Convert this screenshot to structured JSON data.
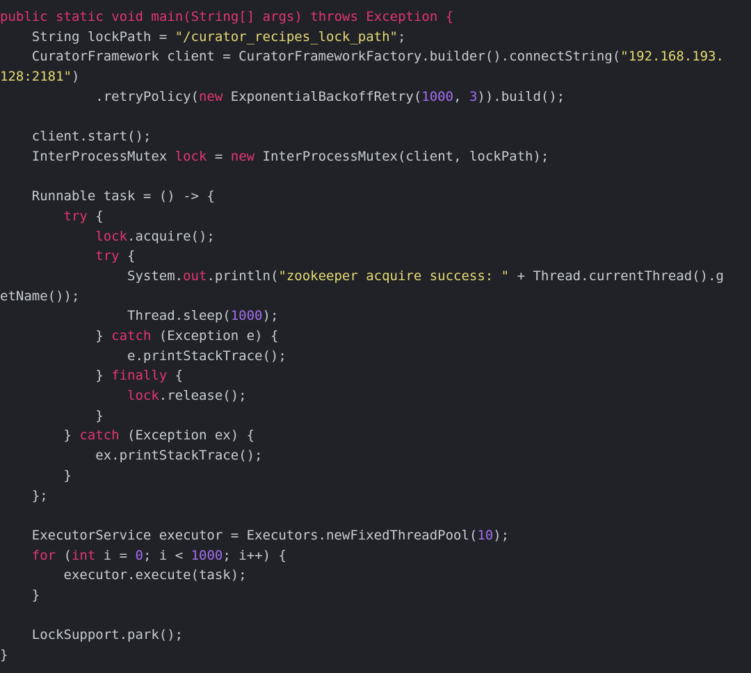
{
  "editor": {
    "language": "java",
    "background_color": "#212227",
    "default_text_color": "#c8cdd4",
    "keyword_color": "#e3366f",
    "string_color": "#e6db74",
    "number_color": "#a06ef0",
    "font_size_px": 19,
    "line_height_px": 28.7,
    "word_wrap": true,
    "total_visual_lines": 33
  },
  "code": {
    "lines": [
      {
        "index": 0,
        "text": "public static void main(String[] args) throws Exception {",
        "tokens": [
          {
            "t": "public",
            "c": "kw"
          },
          {
            "t": " ",
            "c": "pln"
          },
          {
            "t": "static",
            "c": "kw"
          },
          {
            "t": " ",
            "c": "pln"
          },
          {
            "t": "void",
            "c": "kw"
          },
          {
            "t": " ",
            "c": "pln"
          },
          {
            "t": "main",
            "c": "ent"
          },
          {
            "t": "(",
            "c": "ent"
          },
          {
            "t": "String[]",
            "c": "ent"
          },
          {
            "t": " ",
            "c": "pln"
          },
          {
            "t": "args",
            "c": "ent"
          },
          {
            "t": ")",
            "c": "ent"
          },
          {
            "t": " ",
            "c": "pln"
          },
          {
            "t": "throws",
            "c": "kw"
          },
          {
            "t": " ",
            "c": "pln"
          },
          {
            "t": "Exception",
            "c": "ent"
          },
          {
            "t": " {",
            "c": "ent"
          }
        ]
      },
      {
        "index": 1,
        "text": "    String lockPath = \"/curator_recipes_lock_path\";",
        "tokens": [
          {
            "t": "    String lockPath = ",
            "c": "pln"
          },
          {
            "t": "\"/curator_recipes_lock_path\"",
            "c": "str"
          },
          {
            "t": ";",
            "c": "pln"
          }
        ]
      },
      {
        "index": 2,
        "text": "    CuratorFramework client = CuratorFrameworkFactory.builder().connectString(\"192.168.193.128:2181\")",
        "wrapped": true,
        "tokens": [
          {
            "t": "    CuratorFramework client = CuratorFrameworkFactory.builder().connectString(",
            "c": "pln"
          },
          {
            "t": "\"192.168.193.",
            "c": "str"
          },
          {
            "t": "\n",
            "c": "wrap"
          },
          {
            "t": "128:2181\"",
            "c": "str"
          },
          {
            "t": ")",
            "c": "pln"
          }
        ]
      },
      {
        "index": 3,
        "text": "            .retryPolicy(new ExponentialBackoffRetry(1000, 3)).build();",
        "tokens": [
          {
            "t": "            .retryPolicy(",
            "c": "pln"
          },
          {
            "t": "new",
            "c": "kw"
          },
          {
            "t": " ExponentialBackoffRetry(",
            "c": "pln"
          },
          {
            "t": "1000",
            "c": "num"
          },
          {
            "t": ", ",
            "c": "pln"
          },
          {
            "t": "3",
            "c": "num"
          },
          {
            "t": ")).build();",
            "c": "pln"
          }
        ]
      },
      {
        "index": 4,
        "text": "",
        "tokens": []
      },
      {
        "index": 5,
        "text": "    client.start();",
        "tokens": [
          {
            "t": "    client.start();",
            "c": "pln"
          }
        ]
      },
      {
        "index": 6,
        "text": "    InterProcessMutex lock = new InterProcessMutex(client, lockPath);",
        "tokens": [
          {
            "t": "    InterProcessMutex ",
            "c": "pln"
          },
          {
            "t": "lock",
            "c": "ent"
          },
          {
            "t": " = ",
            "c": "pln"
          },
          {
            "t": "new",
            "c": "kw"
          },
          {
            "t": " InterProcessMutex(client, lockPath);",
            "c": "pln"
          }
        ]
      },
      {
        "index": 7,
        "text": "",
        "tokens": []
      },
      {
        "index": 8,
        "text": "    Runnable task = () -> {",
        "tokens": [
          {
            "t": "    Runnable task = () -> {",
            "c": "pln"
          }
        ]
      },
      {
        "index": 9,
        "text": "        try {",
        "tokens": [
          {
            "t": "        ",
            "c": "pln"
          },
          {
            "t": "try",
            "c": "kw"
          },
          {
            "t": " {",
            "c": "pln"
          }
        ]
      },
      {
        "index": 10,
        "text": "            lock.acquire();",
        "tokens": [
          {
            "t": "            ",
            "c": "pln"
          },
          {
            "t": "lock",
            "c": "ent"
          },
          {
            "t": ".acquire();",
            "c": "pln"
          }
        ]
      },
      {
        "index": 11,
        "text": "            try {",
        "tokens": [
          {
            "t": "            ",
            "c": "pln"
          },
          {
            "t": "try",
            "c": "kw"
          },
          {
            "t": " {",
            "c": "pln"
          }
        ]
      },
      {
        "index": 12,
        "text": "                System.out.println(\"zookeeper acquire success: \" + Thread.currentThread().getName());",
        "wrapped": true,
        "tokens": [
          {
            "t": "                System.",
            "c": "pln"
          },
          {
            "t": "out",
            "c": "ent"
          },
          {
            "t": ".println(",
            "c": "pln"
          },
          {
            "t": "\"zookeeper acquire success: \"",
            "c": "str"
          },
          {
            "t": " + Thread.currentThread().g",
            "c": "pln"
          },
          {
            "t": "\n",
            "c": "wrap"
          },
          {
            "t": "etName());",
            "c": "pln"
          }
        ]
      },
      {
        "index": 13,
        "text": "                Thread.sleep(1000);",
        "tokens": [
          {
            "t": "                Thread.sleep(",
            "c": "pln"
          },
          {
            "t": "1000",
            "c": "num"
          },
          {
            "t": ");",
            "c": "pln"
          }
        ]
      },
      {
        "index": 14,
        "text": "            } catch (Exception e) {",
        "tokens": [
          {
            "t": "            } ",
            "c": "pln"
          },
          {
            "t": "catch",
            "c": "kw"
          },
          {
            "t": " (Exception e) {",
            "c": "pln"
          }
        ]
      },
      {
        "index": 15,
        "text": "                e.printStackTrace();",
        "tokens": [
          {
            "t": "                e.printStackTrace();",
            "c": "pln"
          }
        ]
      },
      {
        "index": 16,
        "text": "            } finally {",
        "tokens": [
          {
            "t": "            } ",
            "c": "pln"
          },
          {
            "t": "finally",
            "c": "kw"
          },
          {
            "t": " {",
            "c": "pln"
          }
        ]
      },
      {
        "index": 17,
        "text": "                lock.release();",
        "tokens": [
          {
            "t": "                ",
            "c": "pln"
          },
          {
            "t": "lock",
            "c": "ent"
          },
          {
            "t": ".release();",
            "c": "pln"
          }
        ]
      },
      {
        "index": 18,
        "text": "            }",
        "tokens": [
          {
            "t": "            }",
            "c": "pln"
          }
        ]
      },
      {
        "index": 19,
        "text": "        } catch (Exception ex) {",
        "tokens": [
          {
            "t": "        } ",
            "c": "pln"
          },
          {
            "t": "catch",
            "c": "kw"
          },
          {
            "t": " (Exception ex) {",
            "c": "pln"
          }
        ]
      },
      {
        "index": 20,
        "text": "            ex.printStackTrace();",
        "tokens": [
          {
            "t": "            ex.printStackTrace();",
            "c": "pln"
          }
        ]
      },
      {
        "index": 21,
        "text": "        }",
        "tokens": [
          {
            "t": "        }",
            "c": "pln"
          }
        ]
      },
      {
        "index": 22,
        "text": "    };",
        "tokens": [
          {
            "t": "    };",
            "c": "pln"
          }
        ]
      },
      {
        "index": 23,
        "text": "",
        "tokens": []
      },
      {
        "index": 24,
        "text": "    ExecutorService executor = Executors.newFixedThreadPool(10);",
        "tokens": [
          {
            "t": "    ExecutorService executor = Executors.newFixedThreadPool(",
            "c": "pln"
          },
          {
            "t": "10",
            "c": "num"
          },
          {
            "t": ");",
            "c": "pln"
          }
        ]
      },
      {
        "index": 25,
        "text": "    for (int i = 0; i < 1000; i++) {",
        "tokens": [
          {
            "t": "    ",
            "c": "pln"
          },
          {
            "t": "for",
            "c": "kw"
          },
          {
            "t": " (",
            "c": "pln"
          },
          {
            "t": "int",
            "c": "kw"
          },
          {
            "t": " i = ",
            "c": "pln"
          },
          {
            "t": "0",
            "c": "num"
          },
          {
            "t": "; i < ",
            "c": "pln"
          },
          {
            "t": "1000",
            "c": "num"
          },
          {
            "t": "; i++) {",
            "c": "pln"
          }
        ]
      },
      {
        "index": 26,
        "text": "        executor.execute(task);",
        "tokens": [
          {
            "t": "        executor.execute(task);",
            "c": "pln"
          }
        ]
      },
      {
        "index": 27,
        "text": "    }",
        "tokens": [
          {
            "t": "    }",
            "c": "pln"
          }
        ]
      },
      {
        "index": 28,
        "text": "",
        "tokens": []
      },
      {
        "index": 29,
        "text": "    LockSupport.park();",
        "tokens": [
          {
            "t": "    LockSupport.park();",
            "c": "pln"
          }
        ]
      },
      {
        "index": 30,
        "text": "}",
        "tokens": [
          {
            "t": "}",
            "c": "pln"
          }
        ]
      }
    ]
  }
}
